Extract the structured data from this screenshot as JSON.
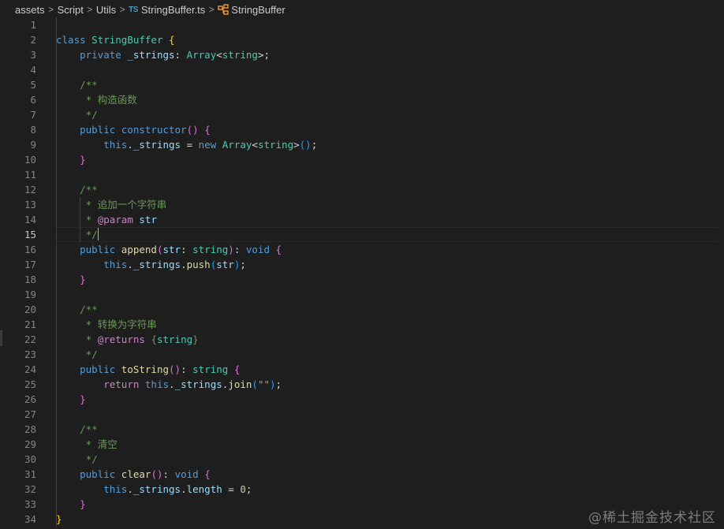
{
  "breadcrumb": {
    "items": [
      "assets",
      "Script",
      "Utils"
    ],
    "file_icon": "TS",
    "file_name": "StringBuffer.ts",
    "symbol_icon": "class-symbol-icon",
    "symbol_name": "StringBuffer",
    "separator": ">"
  },
  "editor": {
    "active_line": 15,
    "colors": {
      "keyword": "#569cd6",
      "control": "#c586c0",
      "type": "#4ec9b0",
      "function": "#dcdcaa",
      "variable": "#9cdcfe",
      "comment": "#6a9955",
      "string": "#ce9178",
      "number": "#b5cea8",
      "text": "#d4d4d4",
      "bracket1": "#ffd700",
      "bracket2": "#da70d6",
      "bracket3": "#179fff"
    },
    "lines": [
      {
        "n": "1",
        "tokens": []
      },
      {
        "n": "2",
        "tokens": [
          [
            "class",
            "keyword"
          ],
          [
            " ",
            "text"
          ],
          [
            "StringBuffer",
            "type"
          ],
          [
            " ",
            "text"
          ],
          [
            "{",
            "bracket1"
          ]
        ]
      },
      {
        "n": "3",
        "tokens": [
          [
            "    ",
            "text"
          ],
          [
            "private",
            "keyword"
          ],
          [
            " ",
            "text"
          ],
          [
            "_strings",
            "variable"
          ],
          [
            ": ",
            "text"
          ],
          [
            "Array",
            "type"
          ],
          [
            "<",
            "text"
          ],
          [
            "string",
            "type"
          ],
          [
            ">;",
            "text"
          ]
        ]
      },
      {
        "n": "4",
        "tokens": []
      },
      {
        "n": "5",
        "tokens": [
          [
            "    ",
            "text"
          ],
          [
            "/**",
            "comment"
          ]
        ]
      },
      {
        "n": "6",
        "tokens": [
          [
            "     ",
            "text"
          ],
          [
            "* 构造函数",
            "comment"
          ]
        ]
      },
      {
        "n": "7",
        "tokens": [
          [
            "     ",
            "text"
          ],
          [
            "*/",
            "comment"
          ]
        ]
      },
      {
        "n": "8",
        "tokens": [
          [
            "    ",
            "text"
          ],
          [
            "public",
            "keyword"
          ],
          [
            " ",
            "text"
          ],
          [
            "constructor",
            "keyword"
          ],
          [
            "()",
            "bracket2"
          ],
          [
            " ",
            "text"
          ],
          [
            "{",
            "bracket2"
          ]
        ]
      },
      {
        "n": "9",
        "tokens": [
          [
            "        ",
            "text"
          ],
          [
            "this",
            "keyword"
          ],
          [
            ".",
            "text"
          ],
          [
            "_strings",
            "variable"
          ],
          [
            " = ",
            "text"
          ],
          [
            "new",
            "keyword"
          ],
          [
            " ",
            "text"
          ],
          [
            "Array",
            "type"
          ],
          [
            "<",
            "text"
          ],
          [
            "string",
            "type"
          ],
          [
            ">",
            "text"
          ],
          [
            "()",
            "bracket3"
          ],
          [
            ";",
            "text"
          ]
        ]
      },
      {
        "n": "10",
        "tokens": [
          [
            "    ",
            "text"
          ],
          [
            "}",
            "bracket2"
          ]
        ]
      },
      {
        "n": "11",
        "tokens": []
      },
      {
        "n": "12",
        "tokens": [
          [
            "    ",
            "text"
          ],
          [
            "/**",
            "comment"
          ]
        ]
      },
      {
        "n": "13",
        "tokens": [
          [
            "     ",
            "text"
          ],
          [
            "* 追加一个字符串",
            "comment"
          ]
        ]
      },
      {
        "n": "14",
        "tokens": [
          [
            "     ",
            "text"
          ],
          [
            "* ",
            "comment"
          ],
          [
            "@param",
            "control"
          ],
          [
            " ",
            "comment"
          ],
          [
            "str",
            "variable"
          ]
        ]
      },
      {
        "n": "15",
        "tokens": [
          [
            "     ",
            "text"
          ],
          [
            "*/",
            "comment"
          ]
        ],
        "cursor": true
      },
      {
        "n": "16",
        "tokens": [
          [
            "    ",
            "text"
          ],
          [
            "public",
            "keyword"
          ],
          [
            " ",
            "text"
          ],
          [
            "append",
            "function"
          ],
          [
            "(",
            "bracket2"
          ],
          [
            "str",
            "variable"
          ],
          [
            ": ",
            "text"
          ],
          [
            "string",
            "type"
          ],
          [
            ")",
            "bracket2"
          ],
          [
            ": ",
            "text"
          ],
          [
            "void",
            "keyword"
          ],
          [
            " ",
            "text"
          ],
          [
            "{",
            "bracket2"
          ]
        ]
      },
      {
        "n": "17",
        "tokens": [
          [
            "        ",
            "text"
          ],
          [
            "this",
            "keyword"
          ],
          [
            ".",
            "text"
          ],
          [
            "_strings",
            "variable"
          ],
          [
            ".",
            "text"
          ],
          [
            "push",
            "function"
          ],
          [
            "(",
            "bracket3"
          ],
          [
            "str",
            "variable"
          ],
          [
            ")",
            "bracket3"
          ],
          [
            ";",
            "text"
          ]
        ]
      },
      {
        "n": "18",
        "tokens": [
          [
            "    ",
            "text"
          ],
          [
            "}",
            "bracket2"
          ]
        ]
      },
      {
        "n": "19",
        "tokens": []
      },
      {
        "n": "20",
        "tokens": [
          [
            "    ",
            "text"
          ],
          [
            "/**",
            "comment"
          ]
        ]
      },
      {
        "n": "21",
        "tokens": [
          [
            "     ",
            "text"
          ],
          [
            "* 转换为字符串",
            "comment"
          ]
        ]
      },
      {
        "n": "22",
        "tokens": [
          [
            "     ",
            "text"
          ],
          [
            "* ",
            "comment"
          ],
          [
            "@returns",
            "control"
          ],
          [
            " ",
            "comment"
          ],
          [
            "{",
            "comment"
          ],
          [
            "string",
            "type"
          ],
          [
            "}",
            "comment"
          ]
        ]
      },
      {
        "n": "23",
        "tokens": [
          [
            "     ",
            "text"
          ],
          [
            "*/",
            "comment"
          ]
        ]
      },
      {
        "n": "24",
        "tokens": [
          [
            "    ",
            "text"
          ],
          [
            "public",
            "keyword"
          ],
          [
            " ",
            "text"
          ],
          [
            "toString",
            "function"
          ],
          [
            "()",
            "bracket2"
          ],
          [
            ": ",
            "text"
          ],
          [
            "string",
            "type"
          ],
          [
            " ",
            "text"
          ],
          [
            "{",
            "bracket2"
          ]
        ]
      },
      {
        "n": "25",
        "tokens": [
          [
            "        ",
            "text"
          ],
          [
            "return",
            "control"
          ],
          [
            " ",
            "text"
          ],
          [
            "this",
            "keyword"
          ],
          [
            ".",
            "text"
          ],
          [
            "_strings",
            "variable"
          ],
          [
            ".",
            "text"
          ],
          [
            "join",
            "function"
          ],
          [
            "(",
            "bracket3"
          ],
          [
            "\"\"",
            "string"
          ],
          [
            ")",
            "bracket3"
          ],
          [
            ";",
            "text"
          ]
        ]
      },
      {
        "n": "26",
        "tokens": [
          [
            "    ",
            "text"
          ],
          [
            "}",
            "bracket2"
          ]
        ]
      },
      {
        "n": "27",
        "tokens": []
      },
      {
        "n": "28",
        "tokens": [
          [
            "    ",
            "text"
          ],
          [
            "/**",
            "comment"
          ]
        ]
      },
      {
        "n": "29",
        "tokens": [
          [
            "     ",
            "text"
          ],
          [
            "* 清空",
            "comment"
          ]
        ]
      },
      {
        "n": "30",
        "tokens": [
          [
            "     ",
            "text"
          ],
          [
            "*/",
            "comment"
          ]
        ]
      },
      {
        "n": "31",
        "tokens": [
          [
            "    ",
            "text"
          ],
          [
            "public",
            "keyword"
          ],
          [
            " ",
            "text"
          ],
          [
            "clear",
            "function"
          ],
          [
            "()",
            "bracket2"
          ],
          [
            ": ",
            "text"
          ],
          [
            "void",
            "keyword"
          ],
          [
            " ",
            "text"
          ],
          [
            "{",
            "bracket2"
          ]
        ]
      },
      {
        "n": "32",
        "tokens": [
          [
            "        ",
            "text"
          ],
          [
            "this",
            "keyword"
          ],
          [
            ".",
            "text"
          ],
          [
            "_strings",
            "variable"
          ],
          [
            ".",
            "text"
          ],
          [
            "length",
            "variable"
          ],
          [
            " = ",
            "text"
          ],
          [
            "0",
            "number"
          ],
          [
            ";",
            "text"
          ]
        ]
      },
      {
        "n": "33",
        "tokens": [
          [
            "    ",
            "text"
          ],
          [
            "}",
            "bracket2"
          ]
        ]
      },
      {
        "n": "34",
        "tokens": [
          [
            "}",
            "bracket1"
          ]
        ]
      }
    ]
  },
  "watermark": "@稀土掘金技术社区"
}
